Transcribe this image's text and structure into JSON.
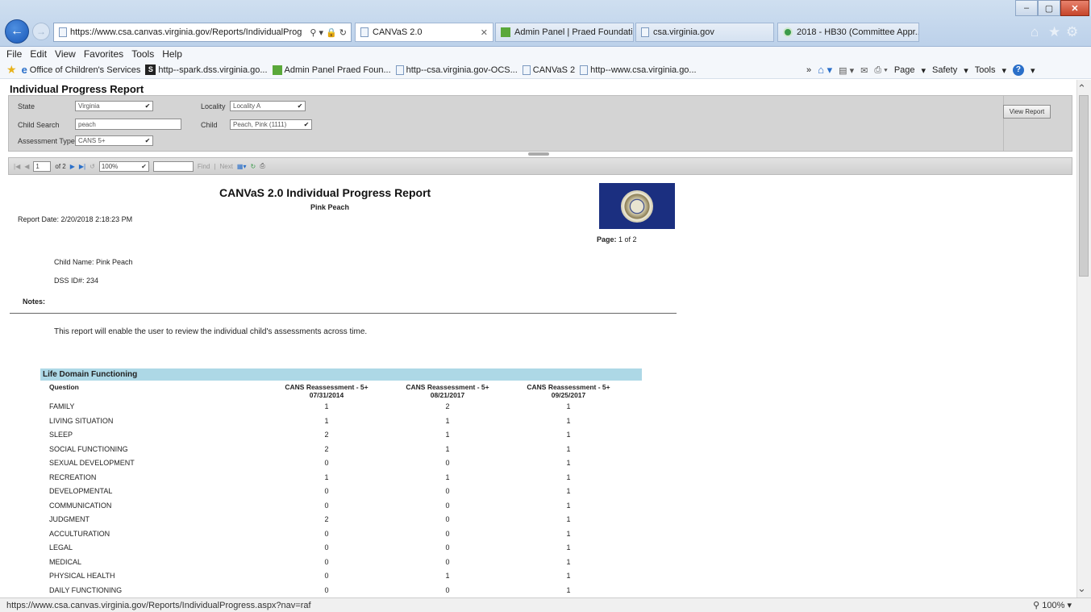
{
  "browser": {
    "url": "https://www.csa.canvas.virginia.gov/Reports/IndividualProg",
    "tabs": [
      {
        "label": "CANVaS 2.0",
        "active": true
      },
      {
        "label": "Admin Panel | Praed Foundati...",
        "active": false
      },
      {
        "label": "csa.virginia.gov",
        "active": false
      },
      {
        "label": "2018 - HB30 (Committee Appr...",
        "active": false
      }
    ],
    "menu": [
      "File",
      "Edit",
      "View",
      "Favorites",
      "Tools",
      "Help"
    ],
    "favorites": [
      "Office of Children's Services",
      "http--spark.dss.virginia.go...",
      "Admin Panel  Praed Foun...",
      "http--csa.virginia.gov-OCS...",
      "CANVaS 2",
      "http--www.csa.virginia.go..."
    ],
    "commands": [
      "Page",
      "Safety",
      "Tools"
    ],
    "status_url": "https://www.csa.canvas.virginia.gov/Reports/IndividualProgress.aspx?nav=raf",
    "zoom": "100%"
  },
  "page": {
    "heading": "Individual Progress Report",
    "params": {
      "state_label": "State",
      "state_value": "Virginia",
      "locality_label": "Locality",
      "locality_value": "Locality A",
      "child_search_label": "Child Search",
      "child_search_value": "peach",
      "child_label": "Child",
      "child_value": "Peach, Pink  (1111)",
      "assessment_type_label": "Assessment Type",
      "assessment_type_value": "CANS 5+",
      "view_report": "View Report"
    },
    "viewer_toolbar": {
      "page_value": "1",
      "page_of": "of 2",
      "zoom_value": "100%",
      "find": "Find",
      "sep": "|",
      "next": "Next"
    }
  },
  "report": {
    "title": "CANVaS 2.0 Individual Progress Report",
    "subtitle": "Pink Peach",
    "date": "Report Date: 2/20/2018 2:18:23 PM",
    "page_label": "Page:",
    "page_value": "1 of 2",
    "child_name": "Child Name: Pink Peach",
    "dss_id": "DSS ID#: 234",
    "notes_label": "Notes:",
    "intro": "This report will enable the user to review the individual child's assessments across time.",
    "section": "Life Domain Functioning",
    "question_header": "Question",
    "columns": [
      {
        "name": "CANS Reassessment - 5+",
        "date": "07/31/2014"
      },
      {
        "name": "CANS Reassessment - 5+",
        "date": "08/21/2017"
      },
      {
        "name": "CANS Reassessment - 5+",
        "date": "09/25/2017"
      }
    ],
    "rows": [
      {
        "q": "FAMILY",
        "v": [
          "1",
          "2",
          "1"
        ]
      },
      {
        "q": "LIVING SITUATION",
        "v": [
          "1",
          "1",
          "1"
        ]
      },
      {
        "q": "SLEEP",
        "v": [
          "2",
          "1",
          "1"
        ]
      },
      {
        "q": "SOCIAL FUNCTIONING",
        "v": [
          "2",
          "1",
          "1"
        ]
      },
      {
        "q": "SEXUAL DEVELOPMENT",
        "v": [
          "0",
          "0",
          "1"
        ]
      },
      {
        "q": "RECREATION",
        "v": [
          "1",
          "1",
          "1"
        ]
      },
      {
        "q": "DEVELOPMENTAL",
        "v": [
          "0",
          "0",
          "1"
        ]
      },
      {
        "q": "COMMUNICATION",
        "v": [
          "0",
          "0",
          "1"
        ]
      },
      {
        "q": "JUDGMENT",
        "v": [
          "2",
          "0",
          "1"
        ]
      },
      {
        "q": "ACCULTURATION",
        "v": [
          "0",
          "0",
          "1"
        ]
      },
      {
        "q": "LEGAL",
        "v": [
          "0",
          "0",
          "1"
        ]
      },
      {
        "q": "MEDICAL",
        "v": [
          "0",
          "0",
          "1"
        ]
      },
      {
        "q": "PHYSICAL HEALTH",
        "v": [
          "0",
          "1",
          "1"
        ]
      },
      {
        "q": "DAILY FUNCTIONING",
        "v": [
          "0",
          "0",
          "1"
        ]
      }
    ]
  }
}
